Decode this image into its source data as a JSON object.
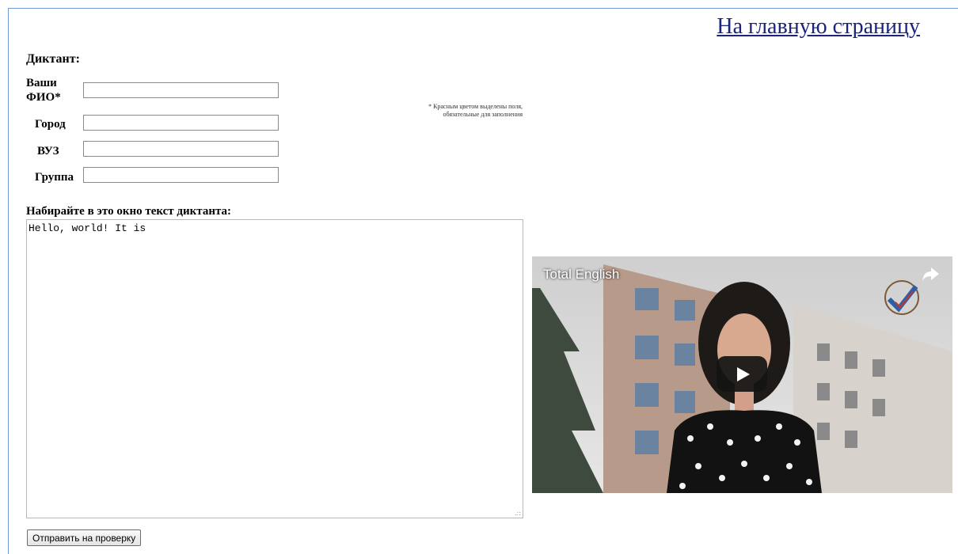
{
  "nav": {
    "home_link": "На главную страницу"
  },
  "form": {
    "title": "Диктант:",
    "fields": [
      {
        "label": "Ваши ФИО*",
        "value": ""
      },
      {
        "label": "Город",
        "value": ""
      },
      {
        "label": "ВУЗ",
        "value": ""
      },
      {
        "label": "Группа",
        "value": ""
      }
    ],
    "required_note": "* Красным цветом выделены поля, обязательные для заполнения",
    "dictation_label": "Набирайте в это окно текст диктанта:",
    "dictation_text": "Hello, world! It is",
    "submit_label": "Отправить на проверку"
  },
  "video": {
    "title": "Total English",
    "icons": [
      "share-icon",
      "play-icon",
      "channel-logo"
    ],
    "play_button_color": "#141414"
  },
  "colors": {
    "link": "#1a237e",
    "frame_border": "#6e9bd3"
  }
}
